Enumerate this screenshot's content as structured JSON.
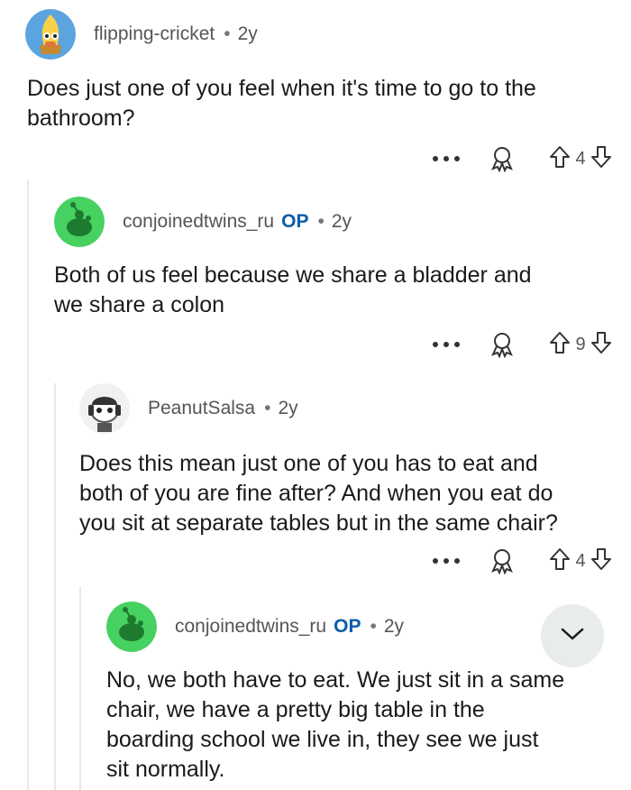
{
  "comments": [
    {
      "username": "flipping-cricket",
      "op": "",
      "separator": "•",
      "age": "2y",
      "body_lines": [
        "Does just one of you feel when it's time to go to the",
        "bathroom?"
      ],
      "votes": "4",
      "avatar_icon": "snoo-yellow-avatar-icon"
    },
    {
      "username": "conjoinedtwins_ru",
      "op": "OP",
      "separator": "•",
      "age": "2y",
      "body_lines": [
        "Both of us feel because we share a bladder and",
        "we share a colon"
      ],
      "votes": "9",
      "avatar_icon": "snoo-green-avatar-icon"
    },
    {
      "username": "PeanutSalsa",
      "op": "",
      "separator": "•",
      "age": "2y",
      "body_lines": [
        "Does this mean just one of you has to eat and",
        "both of you are fine after? And when you eat do",
        "you sit at separate tables but in the same chair?"
      ],
      "votes": "4",
      "avatar_icon": "snoo-headphones-avatar-icon"
    },
    {
      "username": "conjoinedtwins_ru",
      "op": "OP",
      "separator": "•",
      "age": "2y",
      "body_lines": [
        "No, we both have to eat. We just sit in a same",
        "chair, we have a pretty big table in the",
        "boarding school we live in, they see we just",
        "sit normally."
      ],
      "votes": "",
      "avatar_icon": "snoo-green-avatar-icon"
    }
  ],
  "colors": {
    "op_blue": "#0c5ca8",
    "thread_line": "#e8e8e8",
    "avatar_green": "#46d160"
  }
}
